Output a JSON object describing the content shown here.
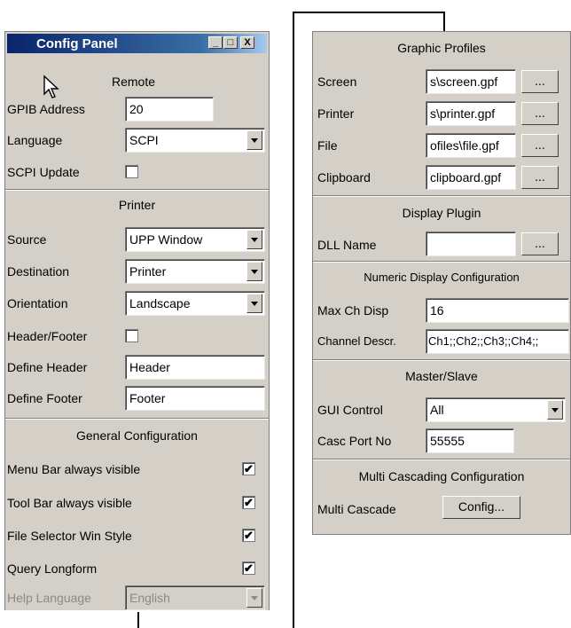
{
  "left_panel": {
    "title": "Config Panel",
    "window_buttons": {
      "minimize": "_",
      "maximize": "□",
      "close": "X"
    },
    "remote": {
      "heading": "Remote",
      "gpib_label": "GPIB Address",
      "gpib_value": "20",
      "language_label": "Language",
      "language_value": "SCPI",
      "scpi_update_label": "SCPI Update",
      "scpi_update_checked": false
    },
    "printer": {
      "heading": "Printer",
      "source_label": "Source",
      "source_value": "UPP Window",
      "destination_label": "Destination",
      "destination_value": "Printer",
      "orientation_label": "Orientation",
      "orientation_value": "Landscape",
      "header_footer_label": "Header/Footer",
      "header_footer_checked": false,
      "define_header_label": "Define Header",
      "define_header_value": "Header",
      "define_footer_label": "Define Footer",
      "define_footer_value": "Footer"
    },
    "general": {
      "heading": "General Configuration",
      "menu_bar_label": "Menu Bar always visible",
      "menu_bar_checked": true,
      "tool_bar_label": "Tool Bar always visible",
      "tool_bar_checked": true,
      "file_selector_label": "File Selector Win Style",
      "file_selector_checked": true,
      "query_longform_label": "Query Longform",
      "query_longform_checked": true,
      "help_language_label": "Help Language",
      "help_language_value": "English"
    }
  },
  "right_panel": {
    "graphic_profiles": {
      "heading": "Graphic Profiles",
      "screen_label": "Screen",
      "screen_value": "s\\screen.gpf",
      "printer_label": "Printer",
      "printer_value": "s\\printer.gpf",
      "file_label": "File",
      "file_value": "ofiles\\file.gpf",
      "clipboard_label": "Clipboard",
      "clipboard_value": "clipboard.gpf",
      "browse_label": "..."
    },
    "display_plugin": {
      "heading": "Display Plugin",
      "dll_label": "DLL Name",
      "dll_value": "",
      "browse_label": "..."
    },
    "numeric_display": {
      "heading": "Numeric Display Configuration",
      "max_ch_label": "Max Ch Disp",
      "max_ch_value": "16",
      "channel_descr_label": "Channel Descr.",
      "channel_descr_value": "Ch1;;Ch2;;Ch3;;Ch4;;"
    },
    "master_slave": {
      "heading": "Master/Slave",
      "gui_control_label": "GUI Control",
      "gui_control_value": "All",
      "casc_port_label": "Casc Port No",
      "casc_port_value": "55555"
    },
    "multi_cascading": {
      "heading": "Multi Cascading Configuration",
      "multi_cascade_label": "Multi Cascade",
      "config_button_label": "Config..."
    }
  }
}
